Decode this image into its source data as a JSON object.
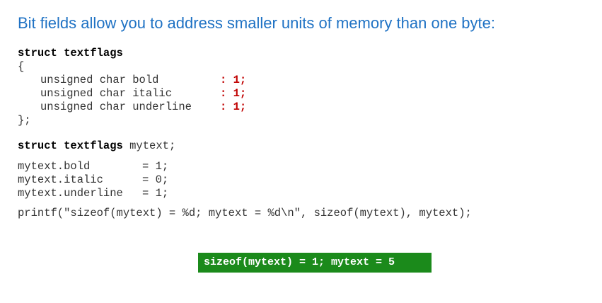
{
  "title": "Bit fields allow you to address smaller units of memory than one byte:",
  "struct_decl": {
    "keyword_line": "struct textflags",
    "open_brace": "{",
    "fields": [
      {
        "decl": "unsigned char bold",
        "width": ": 1;"
      },
      {
        "decl": "unsigned char italic",
        "width": ": 1;"
      },
      {
        "decl": "unsigned char underline",
        "width": ": 1;"
      }
    ],
    "close_brace": "};"
  },
  "instance": {
    "keyword": "struct textflags",
    "name": " mytext;"
  },
  "assignments": [
    {
      "lhs": "mytext.bold",
      "rhs": "= 1;"
    },
    {
      "lhs": "mytext.italic",
      "rhs": "= 0;"
    },
    {
      "lhs": "mytext.underline",
      "rhs": "= 1;"
    }
  ],
  "printf_line": "printf(\"sizeof(mytext) = %d; mytext = %d\\n\", sizeof(mytext), mytext);",
  "output": "sizeof(mytext) = 1; mytext = 5",
  "colors": {
    "title": "#1f72c4",
    "bit_width": "#c00000",
    "output_background": "#1b8a1b"
  }
}
